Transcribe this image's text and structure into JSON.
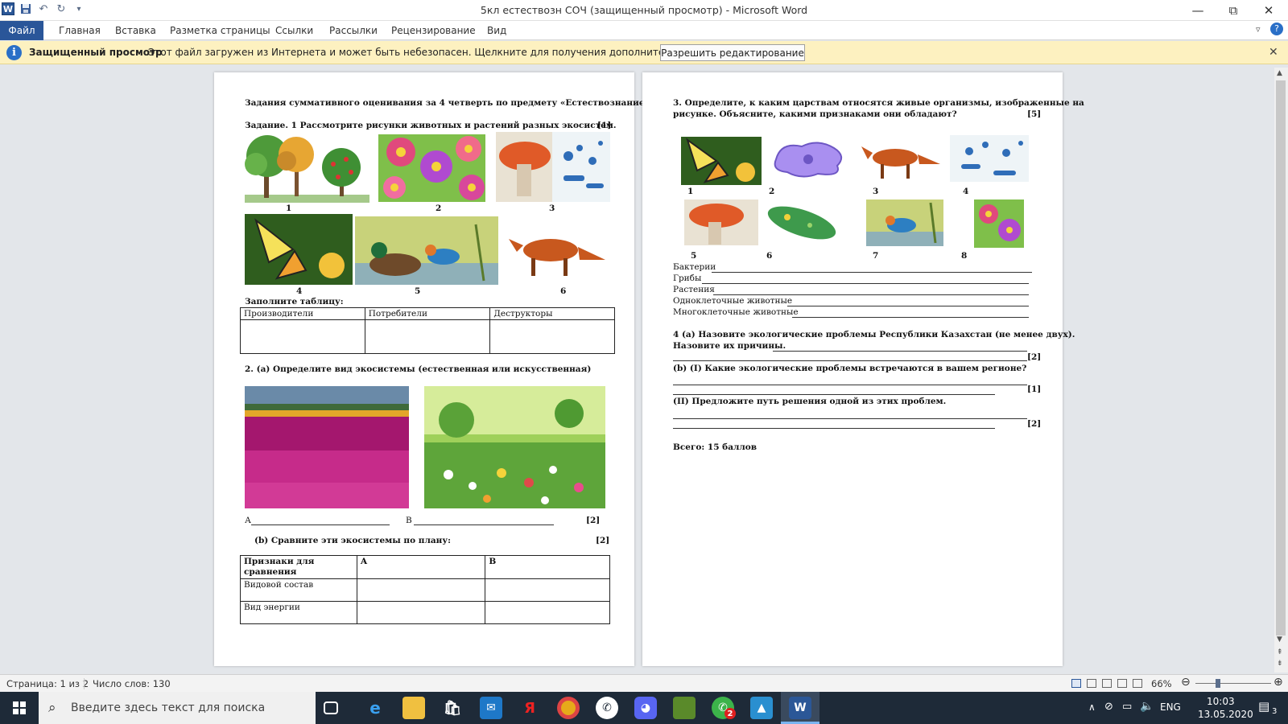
{
  "window": {
    "title": "5кл  естествозн СОЧ (защищенный просмотр)  -  Microsoft Word"
  },
  "ribbon": {
    "tabs": [
      "Файл",
      "Главная",
      "Вставка",
      "Разметка страницы",
      "Ссылки",
      "Рассылки",
      "Рецензирование",
      "Вид"
    ]
  },
  "protected_view": {
    "title": "Защищенный просмотр",
    "message": "Этот файл загружен из Интернета и может быть небезопасен. Щелкните для получения дополнительных сведений.",
    "button": "Разрешить редактирование"
  },
  "page1": {
    "heading": "Задания  суммативного  оценивания  за 4 четверть  по  предмету  «Естествознание».",
    "task1": "Задание. 1  Рассмотрите  рисунки  животных  и  растений  разных  экосистем.",
    "task1_score": "[1]",
    "pic_numbers": [
      "1",
      "2",
      "3",
      "4",
      "5",
      "6"
    ],
    "fill_table_label": "Заполните таблицу:",
    "table1_headers": [
      "Производители",
      "Потребители",
      "Деструкторы"
    ],
    "task2a": "2. (а)  Определите  вид экосистемы  (естественная  или  искусственная)",
    "answer_a": "А",
    "answer_b": "В",
    "task2a_score": "[2]",
    "task2b": "(b)  Сравните  эти  экосистемы  по  плану:",
    "task2b_score": "[2]",
    "table2_headers": [
      "Признаки для сравнения",
      "А",
      "В"
    ],
    "table2_rows": [
      "Видовой состав",
      "Вид энергии"
    ]
  },
  "page2": {
    "task3_line1": "3.  Определите,  к  каким  царствам  относятся  живые  организмы,  изображенные  на",
    "task3_line2": "рисунке.  Объясните,  какими  признаками  они  обладают?",
    "task3_score": "[5]",
    "pic_numbers": [
      "1",
      "2",
      "3",
      "4",
      "5",
      "6",
      "7",
      "8"
    ],
    "kingdoms": [
      "Бактерии",
      "Грибы",
      "Растения",
      "Одноклеточные  животные",
      "Многоклеточные  животные"
    ],
    "task4a_line1": "4 (а)  Назовите  экологические  проблемы  Республики  Казахстан  (не  менее  двух).",
    "task4a_line2": "Назовите  их  причины.",
    "task4a_score": "[2]",
    "task4b1": "(b) (I)  Какие  экологические   проблемы   встречаются  в вашем  регионе?",
    "task4b1_score": "[1]",
    "task4b2": "(II)  Предложите  путь  решения  одной  из  этих  проблем.",
    "task4b2_score": "[2]",
    "total": "Всего:  15  баллов"
  },
  "statusbar": {
    "page": "Страница: 1 из 2",
    "words": "Число слов: 130",
    "zoom": "66%"
  },
  "taskbar": {
    "search_placeholder": "Введите здесь текст для поиска",
    "whatsapp_badge": "2",
    "lang": "ENG",
    "time": "10:03",
    "date": "13.05.2020",
    "notification_count": "3"
  },
  "colors": {
    "file_tab": "#2a5699",
    "protected_bar": "#fdf1c0",
    "taskbar": "#1e2a38"
  }
}
